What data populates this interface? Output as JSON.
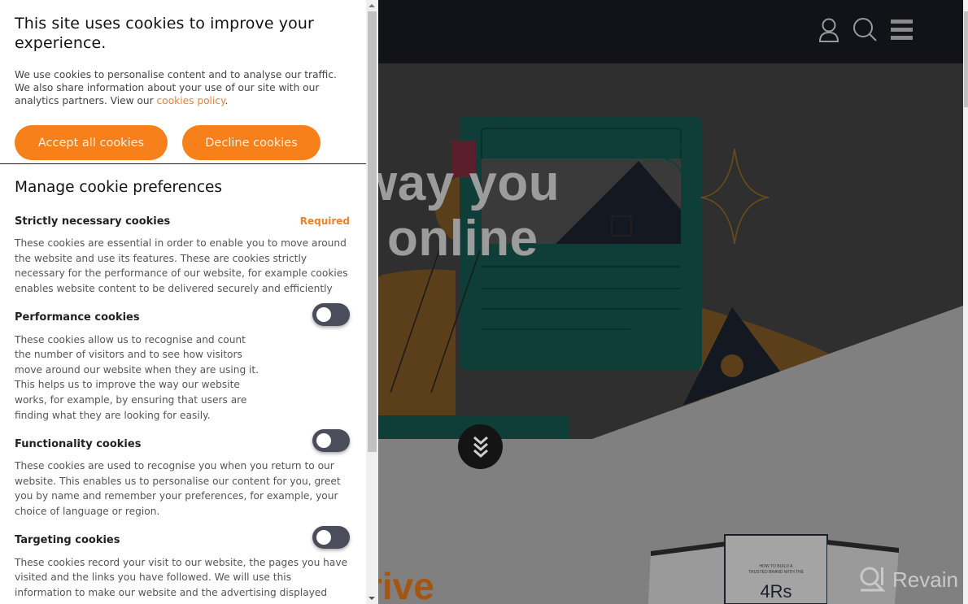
{
  "site": {
    "header_icons": [
      "user-icon",
      "search-icon",
      "menu-icon"
    ],
    "hero": {
      "line1": "way you",
      "line2": "online"
    },
    "section_heading_fragment": "rive",
    "scroll_down_icon": "chevrons-down-icon",
    "watermark": "Revain",
    "colors": {
      "header_bg": "#111318",
      "hero_overlay": "#2f2f2f",
      "accent_orange": "#f7801a",
      "teal": "#0f4a40"
    }
  },
  "cookie_panel": {
    "title": "This site uses cookies to improve your experience.",
    "intro_text": "We use cookies to personalise content and to analyse our traffic. We also share information about your use of our site with our analytics partners. View our ",
    "policy_link": "cookies policy",
    "intro_end": ".",
    "accept_label": "Accept all cookies",
    "decline_label": "Decline cookies",
    "manage_title": "Manage cookie preferences",
    "categories": [
      {
        "name": "Strictly necessary cookies",
        "badge": "Required",
        "description": "These cookies are essential in order to enable you to move around the website and use its features. These are cookies strictly necessary for the performance of our website, for example cookies enables website content to be delivered securely and efficiently"
      },
      {
        "name": "Performance cookies",
        "enabled": false,
        "description": "These cookies allow us to recognise and count the number of visitors and to see how visitors move around our website when they are using it. This helps us to improve the way our website works, for example, by ensuring that users are finding what they are looking for easily."
      },
      {
        "name": "Functionality cookies",
        "enabled": false,
        "description": "These cookies are used to recognise you when you return to our website. This enables us to personalise our content for you, greet you by name and remember your preferences, for example, your choice of language or region."
      },
      {
        "name": "Targeting cookies",
        "enabled": false,
        "description": "These cookies record your visit to our website, the pages you have visited and the links you have followed. We will use this information to make our website and the advertising displayed"
      }
    ],
    "colors": {
      "button_bg": "#f7801a",
      "link": "#e8823a",
      "required": "#e8822c",
      "toggle_off": "#4b4d5b"
    }
  }
}
